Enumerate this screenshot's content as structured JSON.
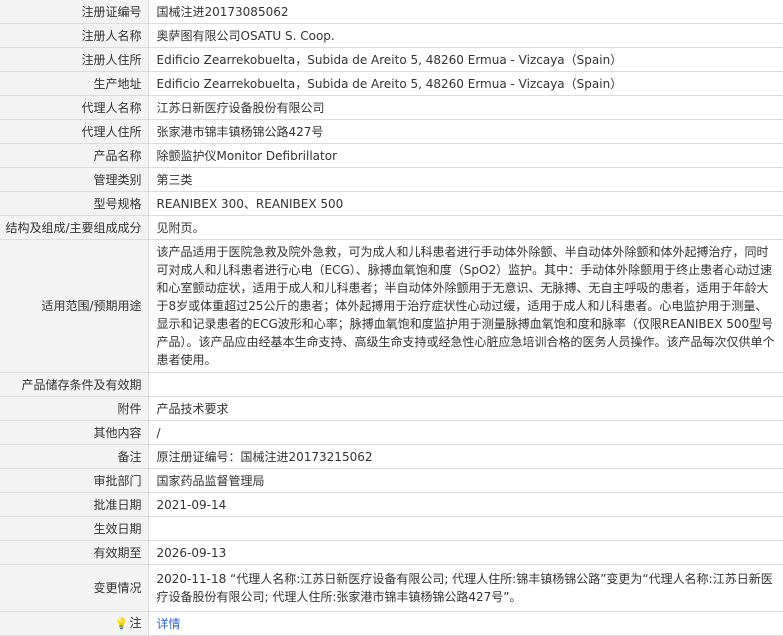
{
  "rows": [
    {
      "label": "注册证编号",
      "value": "国械注进20173085062"
    },
    {
      "label": "注册人名称",
      "value": "奥萨图有限公司OSATU S. Coop."
    },
    {
      "label": "注册人住所",
      "value": "Edificio Zearrekobuelta，Subida de Areito 5, 48260 Ermua - Vizcaya（Spain）"
    },
    {
      "label": "生产地址",
      "value": "Edificio Zearrekobuelta，Subida de Areito 5, 48260 Ermua - Vizcaya（Spain）"
    },
    {
      "label": "代理人名称",
      "value": "江苏日新医疗设备股份有限公司"
    },
    {
      "label": "代理人住所",
      "value": "张家港市锦丰镇杨锦公路427号"
    },
    {
      "label": "产品名称",
      "value": "除颤监护仪Monitor Defibrillator"
    },
    {
      "label": "管理类别",
      "value": "第三类"
    },
    {
      "label": "型号规格",
      "value": "REANIBEX 300、REANIBEX 500"
    },
    {
      "label": "结构及组成/主要组成成分",
      "value": "见附页。"
    },
    {
      "label": "适用范围/预期用途",
      "value": "该产品适用于医院急救及院外急救，可为成人和儿科患者进行手动体外除颤、半自动体外除颤和体外起搏治疗，同时可对成人和儿科患者进行心电（ECG）、脉搏血氧饱和度（SpO2）监护。其中：手动体外除颤用于终止患者心动过速和心室颤动症状，适用于成人和儿科患者；半自动体外除颤用于无意识、无脉搏、无自主呼吸的患者，适用于年龄大于8岁或体重超过25公斤的患者；体外起搏用于治疗症状性心动过缓，适用于成人和儿科患者。心电监护用于测量、显示和记录患者的ECG波形和心率；脉搏血氧饱和度监护用于测量脉搏血氧饱和度和脉率（仅限REANIBEX 500型号产品）。该产品应由经基本生命支持、高级生命支持或经急性心脏应急培训合格的医务人员操作。该产品每次仅供单个患者使用。"
    },
    {
      "label": "产品储存条件及有效期",
      "value": ""
    },
    {
      "label": "附件",
      "value": "产品技术要求"
    },
    {
      "label": "其他内容",
      "value": "/"
    },
    {
      "label": "备注",
      "value": "原注册证编号：国械注进20173215062"
    },
    {
      "label": "审批部门",
      "value": "国家药品监督管理局"
    },
    {
      "label": "批准日期",
      "value": "2021-09-14"
    },
    {
      "label": "生效日期",
      "value": ""
    },
    {
      "label": "有效期至",
      "value": "2026-09-13"
    },
    {
      "label": "变更情况",
      "value": "2020-11-18 “代理人名称:江苏日新医疗设备有限公司; 代理人住所:锦丰镇杨锦公路”变更为“代理人名称:江苏日新医疗设备股份有限公司; 代理人住所:张家港市锦丰镇杨锦公路427号”。"
    }
  ],
  "note": {
    "label": "注",
    "icon": "bulb-icon",
    "link": "详情"
  }
}
